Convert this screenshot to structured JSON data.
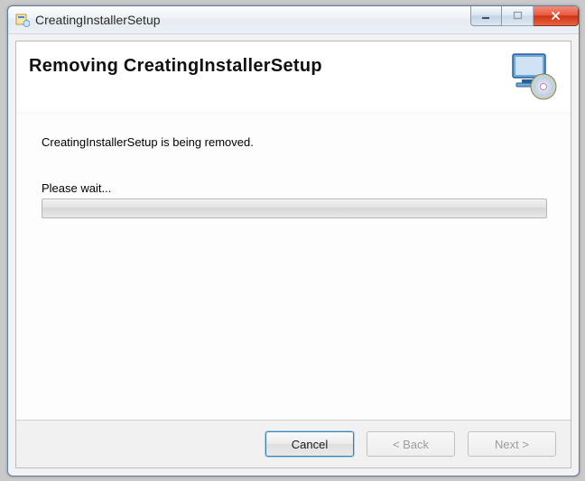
{
  "window": {
    "title": "CreatingInstallerSetup"
  },
  "header": {
    "title": "Removing CreatingInstallerSetup"
  },
  "body": {
    "status_text": "CreatingInstallerSetup is being removed.",
    "wait_label": "Please wait..."
  },
  "footer": {
    "cancel_label": "Cancel",
    "back_label": "< Back",
    "next_label": "Next >",
    "cancel_enabled": true,
    "back_enabled": false,
    "next_enabled": false
  },
  "progress": {
    "percent": 0
  },
  "colors": {
    "close_button": "#d03113",
    "accent_focus": "#3c7fb1"
  }
}
